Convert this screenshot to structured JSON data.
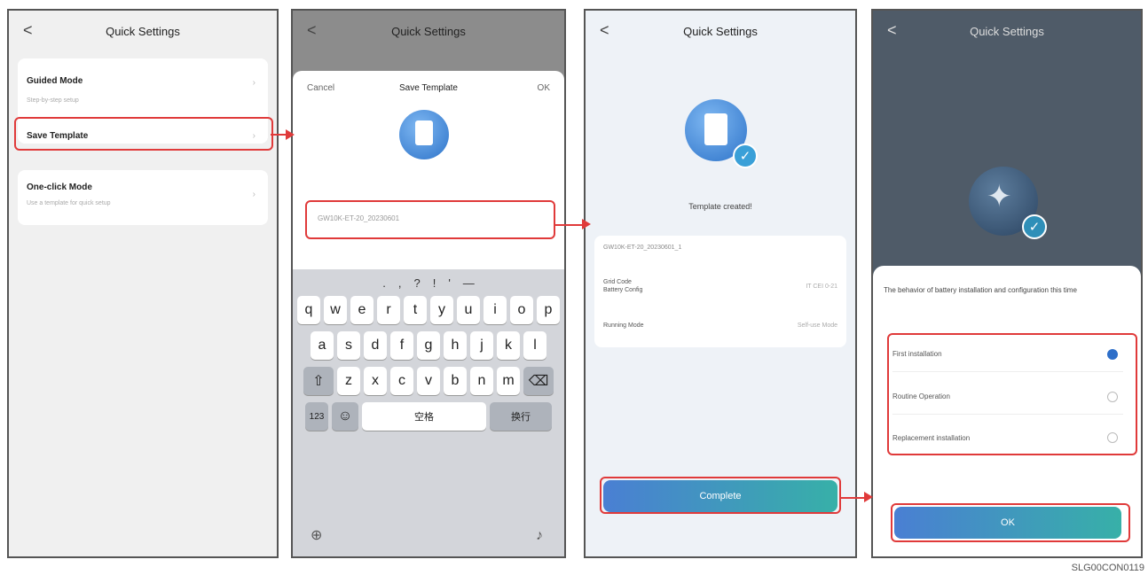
{
  "screen1": {
    "back": "<",
    "title": "Quick Settings",
    "items": [
      {
        "label": "Guided Mode",
        "desc": "Step-by-step setup"
      },
      {
        "label": "Save Template",
        "desc": ""
      },
      {
        "label": "One-click Mode",
        "desc": "Use a template for quick setup"
      }
    ]
  },
  "screen2": {
    "back": "<",
    "title": "Quick Settings",
    "cancel": "Cancel",
    "sheet_title": "Save Template",
    "ok": "OK",
    "input_value": "GW10K-ET-20_20230601",
    "keyboard": {
      "punct_row": [
        ".",
        ",",
        "?",
        "!",
        "'",
        "—"
      ],
      "row1": [
        "q",
        "w",
        "e",
        "r",
        "t",
        "y",
        "u",
        "i",
        "o",
        "p"
      ],
      "row2": [
        "a",
        "s",
        "d",
        "f",
        "g",
        "h",
        "j",
        "k",
        "l"
      ],
      "row3": [
        "z",
        "x",
        "c",
        "v",
        "b",
        "n",
        "m"
      ],
      "num_key": "123",
      "space": "空格",
      "return": "换行"
    }
  },
  "screen3": {
    "back": "<",
    "title": "Quick Settings",
    "status": "Template created!",
    "template_name": "GW10K-ET-20_20230601_1",
    "rows": [
      {
        "label": "Grid Code\nBattery Config",
        "value": "IT CEI 0-21"
      },
      {
        "label": "Running Mode",
        "value": "Self-use Mode"
      }
    ],
    "complete": "Complete"
  },
  "screen4": {
    "back": "<",
    "title": "Quick Settings",
    "question": "The behavior of battery installation and configuration this time",
    "options": [
      {
        "label": "First installation",
        "selected": true
      },
      {
        "label": "Routine Operation",
        "selected": false
      },
      {
        "label": "Replacement installation",
        "selected": false
      }
    ],
    "ok": "OK"
  },
  "caption": "SLG00CON0119",
  "colors": {
    "highlight": "#e03a3a",
    "accent": "#2e6fc9",
    "button_start": "#4a7fd3",
    "button_end": "#37b0a8"
  }
}
